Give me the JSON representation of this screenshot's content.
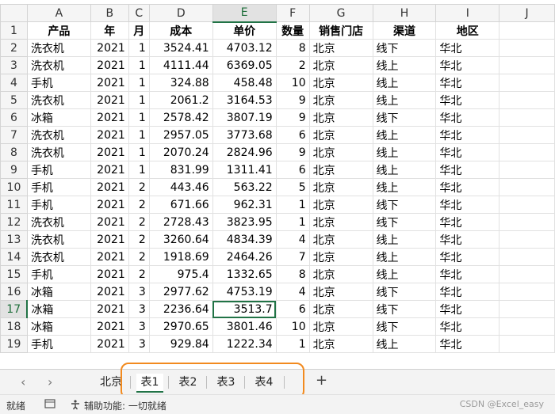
{
  "columns": [
    "A",
    "B",
    "C",
    "D",
    "E",
    "F",
    "G",
    "H",
    "I",
    "J"
  ],
  "header_row": [
    "产品",
    "年",
    "月",
    "成本",
    "单价",
    "数量",
    "销售门店",
    "渠道",
    "地区"
  ],
  "rows": [
    [
      "洗衣机",
      "2021",
      "1",
      "3524.41",
      "4703.12",
      "8",
      "北京",
      "线下",
      "华北"
    ],
    [
      "洗衣机",
      "2021",
      "1",
      "4111.44",
      "6369.05",
      "2",
      "北京",
      "线上",
      "华北"
    ],
    [
      "手机",
      "2021",
      "1",
      "324.88",
      "458.48",
      "10",
      "北京",
      "线上",
      "华北"
    ],
    [
      "洗衣机",
      "2021",
      "1",
      "2061.2",
      "3164.53",
      "9",
      "北京",
      "线上",
      "华北"
    ],
    [
      "冰箱",
      "2021",
      "1",
      "2578.42",
      "3807.19",
      "9",
      "北京",
      "线下",
      "华北"
    ],
    [
      "洗衣机",
      "2021",
      "1",
      "2957.05",
      "3773.68",
      "6",
      "北京",
      "线上",
      "华北"
    ],
    [
      "洗衣机",
      "2021",
      "1",
      "2070.24",
      "2824.96",
      "9",
      "北京",
      "线上",
      "华北"
    ],
    [
      "手机",
      "2021",
      "1",
      "831.99",
      "1311.41",
      "6",
      "北京",
      "线上",
      "华北"
    ],
    [
      "手机",
      "2021",
      "2",
      "443.46",
      "563.22",
      "5",
      "北京",
      "线上",
      "华北"
    ],
    [
      "手机",
      "2021",
      "2",
      "671.66",
      "962.31",
      "1",
      "北京",
      "线下",
      "华北"
    ],
    [
      "洗衣机",
      "2021",
      "2",
      "2728.43",
      "3823.95",
      "1",
      "北京",
      "线下",
      "华北"
    ],
    [
      "洗衣机",
      "2021",
      "2",
      "3260.64",
      "4834.39",
      "4",
      "北京",
      "线上",
      "华北"
    ],
    [
      "洗衣机",
      "2021",
      "2",
      "1918.69",
      "2464.26",
      "7",
      "北京",
      "线上",
      "华北"
    ],
    [
      "手机",
      "2021",
      "2",
      "975.4",
      "1332.65",
      "8",
      "北京",
      "线上",
      "华北"
    ],
    [
      "冰箱",
      "2021",
      "3",
      "2977.62",
      "4753.19",
      "4",
      "北京",
      "线下",
      "华北"
    ],
    [
      "冰箱",
      "2021",
      "3",
      "2236.64",
      "3513.7",
      "6",
      "北京",
      "线下",
      "华北"
    ],
    [
      "冰箱",
      "2021",
      "3",
      "2970.65",
      "3801.46",
      "10",
      "北京",
      "线下",
      "华北"
    ],
    [
      "手机",
      "2021",
      "3",
      "929.84",
      "1222.34",
      "1",
      "北京",
      "线上",
      "华北"
    ]
  ],
  "sheet_tabs": {
    "first_partial": "北京",
    "tabs": [
      "表1",
      "表2",
      "表3",
      "表4"
    ],
    "active": "表1",
    "add": "+",
    "prev": "‹",
    "next": "›"
  },
  "status": {
    "ready": "就绪",
    "accessibility": "辅助功能: 一切就绪",
    "watermark": "CSDN @Excel_easy"
  },
  "selection": {
    "column": "E",
    "row": 17
  }
}
